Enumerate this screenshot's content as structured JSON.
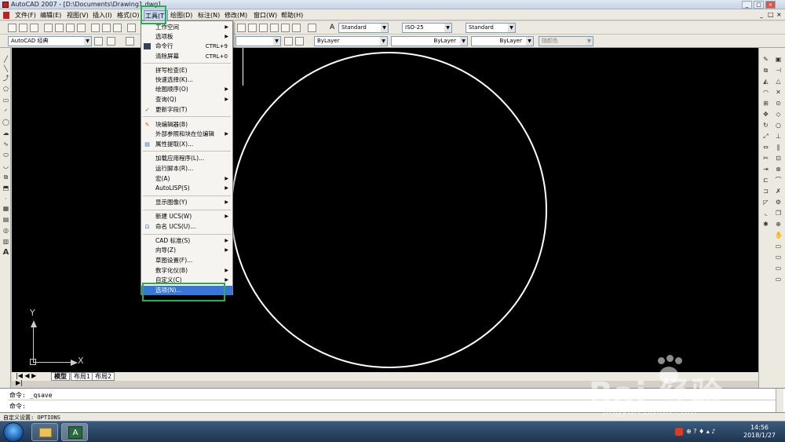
{
  "window": {
    "title": "AutoCAD 2007 - [D:\\Documents\\Drawing1.dwg]",
    "controls": [
      "_",
      "□",
      "×"
    ]
  },
  "menubar": {
    "items": [
      "文件(F)",
      "编辑(E)",
      "视图(V)",
      "插入(I)",
      "格式(O)",
      "工具(T)",
      "绘图(D)",
      "标注(N)",
      "修改(M)",
      "窗口(W)",
      "帮助(H)"
    ]
  },
  "toolbar": {
    "workspace": "AutoCAD 经典",
    "text_style": "Standard",
    "dim_style": "ISO-25",
    "table_style": "Standard",
    "color": "ByLayer",
    "linetype": "ByLayer",
    "lineweight": "ByLayer",
    "plot_style": "随颜色"
  },
  "tools_menu": {
    "items": [
      {
        "label": "工作空间",
        "shortcut": "",
        "submenu": true
      },
      {
        "label": "选项板",
        "shortcut": "",
        "submenu": true
      },
      {
        "label": "命令行",
        "shortcut": "CTRL+9",
        "submenu": false
      },
      {
        "label": "清除屏幕",
        "shortcut": "CTRL+0",
        "submenu": false
      },
      {
        "label": "拼写检查(E)",
        "shortcut": "",
        "submenu": false
      },
      {
        "label": "快速选择(K)...",
        "shortcut": "",
        "submenu": false
      },
      {
        "label": "绘图顺序(O)",
        "shortcut": "",
        "submenu": true
      },
      {
        "label": "查询(Q)",
        "shortcut": "",
        "submenu": true
      },
      {
        "label": "更新字段(T)",
        "shortcut": "",
        "submenu": false
      },
      {
        "label": "块编辑器(B)",
        "shortcut": "",
        "submenu": false
      },
      {
        "label": "外部参照和块在位编辑",
        "shortcut": "",
        "submenu": true
      },
      {
        "label": "属性提取(X)...",
        "shortcut": "",
        "submenu": false
      },
      {
        "label": "加载应用程序(L)...",
        "shortcut": "",
        "submenu": false
      },
      {
        "label": "运行脚本(R)...",
        "shortcut": "",
        "submenu": false
      },
      {
        "label": "宏(A)",
        "shortcut": "",
        "submenu": true
      },
      {
        "label": "AutoLISP(S)",
        "shortcut": "",
        "submenu": true
      },
      {
        "label": "显示图像(Y)",
        "shortcut": "",
        "submenu": true
      },
      {
        "label": "新建 UCS(W)",
        "shortcut": "",
        "submenu": true
      },
      {
        "label": "命名 UCS(U)...",
        "shortcut": "",
        "submenu": false
      },
      {
        "label": "CAD 标准(S)",
        "shortcut": "",
        "submenu": true
      },
      {
        "label": "向导(Z)",
        "shortcut": "",
        "submenu": true
      },
      {
        "label": "草图设置(F)...",
        "shortcut": "",
        "submenu": false
      },
      {
        "label": "数字化仪(B)",
        "shortcut": "",
        "submenu": true
      },
      {
        "label": "自定义(C)",
        "shortcut": "",
        "submenu": true
      },
      {
        "label": "选项(N)...",
        "shortcut": "",
        "submenu": false
      }
    ],
    "selected": "选项(N)..."
  },
  "ucs": {
    "x_label": "X",
    "y_label": "Y"
  },
  "layout_tabs": [
    "模型",
    "布局1",
    "布局2"
  ],
  "command": {
    "history": "命令: _qsave",
    "prompt": "命令:"
  },
  "status": {
    "text": "自定义设置:  OPTIONS"
  },
  "taskbar": {
    "time": "14:56",
    "date": "2018/1/27"
  },
  "watermark": {
    "logo": "Bai  经验",
    "url": "jingyan.baidu.com"
  }
}
